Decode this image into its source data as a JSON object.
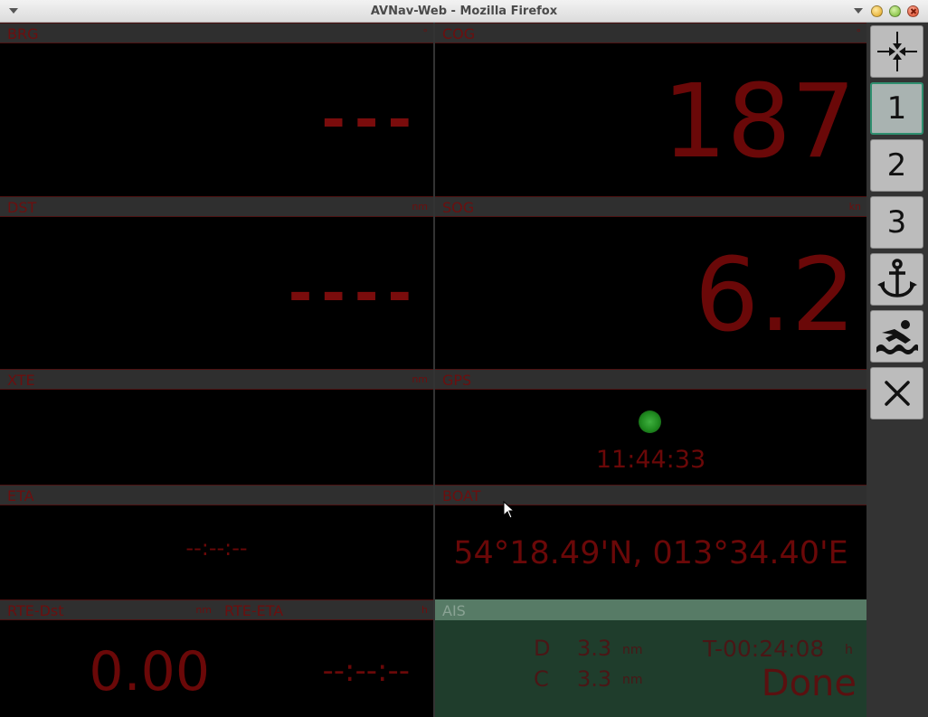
{
  "window": {
    "title": "AVNav-Web - Mozilla Firefox"
  },
  "panels": {
    "brg": {
      "label": "BRG",
      "unit": "°",
      "value": "---"
    },
    "cog": {
      "label": "COG",
      "unit": "°",
      "value": "187"
    },
    "dst": {
      "label": "DST",
      "unit": "nm",
      "value": "----"
    },
    "sog": {
      "label": "SOG",
      "unit": "kn",
      "value": "6.2"
    },
    "xte": {
      "label": "XTE",
      "unit": "nm",
      "value": ""
    },
    "gps": {
      "label": "GPS",
      "time": "11:44:33",
      "status_color": "#1f8a1f"
    },
    "eta": {
      "label": "ETA",
      "value": "--:--:--"
    },
    "boat": {
      "label": "BOAT",
      "value": "54°18.49'N, 013°34.40'E"
    },
    "rte_dst": {
      "label": "RTE-Dst",
      "unit": "nm",
      "value": "0.00"
    },
    "rte_eta": {
      "label": "RTE-ETA",
      "unit": "h",
      "value": "--:--:--"
    },
    "ais": {
      "label": "AIS",
      "d_label": "D",
      "d_value": "3.3",
      "d_unit": "nm",
      "c_label": "C",
      "c_value": "3.3",
      "c_unit": "nm",
      "t_value": "T-00:24:08",
      "t_unit": "h",
      "status": "Done"
    }
  },
  "sidebar": {
    "buttons": [
      {
        "name": "center-icon"
      },
      {
        "label": "1",
        "active": true
      },
      {
        "label": "2"
      },
      {
        "label": "3"
      },
      {
        "name": "anchor-icon"
      },
      {
        "name": "man-overboard-icon"
      },
      {
        "name": "close-icon"
      }
    ]
  },
  "colors": {
    "value_red": "#6a0808",
    "header_gray": "#2f2f2f",
    "ais_green": "#1f3d2c",
    "active_border": "#2f8f6f"
  }
}
